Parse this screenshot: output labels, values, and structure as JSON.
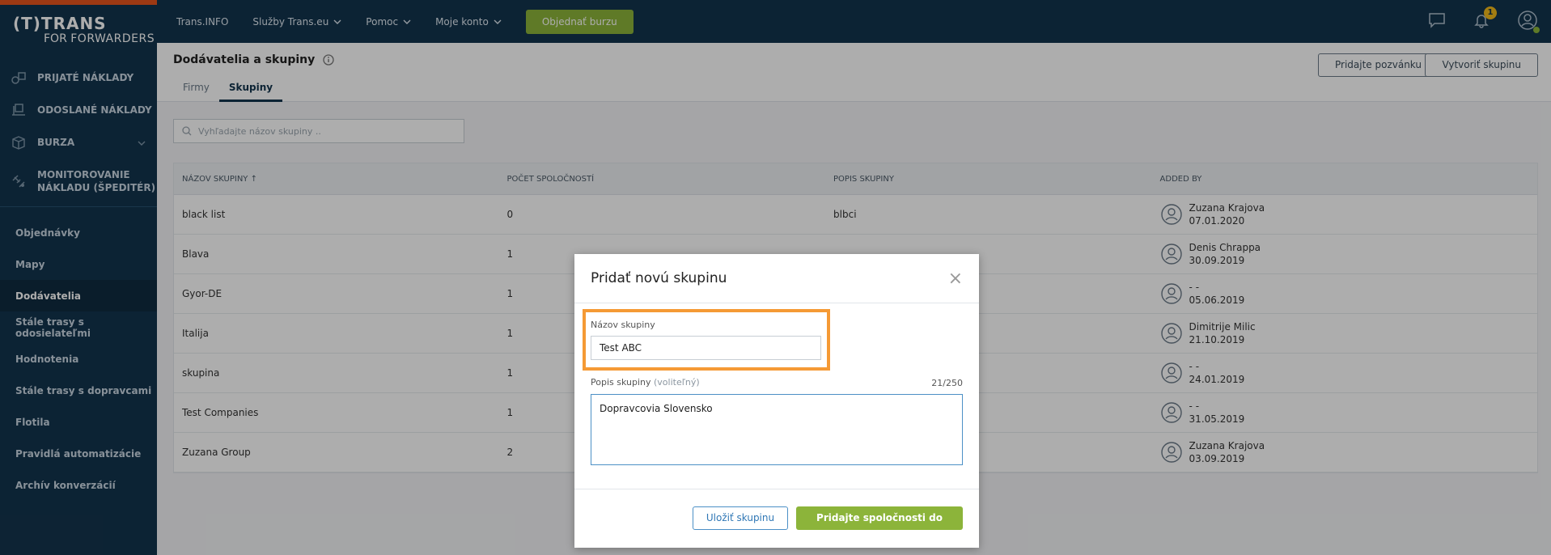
{
  "brand": {
    "line1": "(T)TRANS",
    "line2a": "FOR ",
    "line2b": "FORWARDERS"
  },
  "sidebar": {
    "main": [
      {
        "label": "PRIJATÉ NÁKLADY",
        "icon": "cargo-received-icon"
      },
      {
        "label": "ODOSLANÉ NÁKLADY",
        "icon": "cargo-sent-icon"
      },
      {
        "label": "BURZA",
        "icon": "box-icon"
      },
      {
        "label1": "MONITOROVANIE",
        "label2": "NÁKLADU (ŠPEDITÉR)",
        "icon": "satellite-icon"
      }
    ],
    "sub": [
      {
        "label": "Objednávky"
      },
      {
        "label": "Mapy"
      },
      {
        "label": "Dodávatelia"
      },
      {
        "label": "Stále trasy s odosielateľmi"
      },
      {
        "label": "Hodnotenia"
      },
      {
        "label": "Stále trasy s dopravcami"
      },
      {
        "label": "Flotila"
      },
      {
        "label": "Pravidlá automatizácie"
      },
      {
        "label": "Archív konverzácií"
      }
    ]
  },
  "topnav": {
    "items": [
      "Trans.INFO",
      "Služby Trans.eu",
      "Pomoc",
      "Moje konto"
    ],
    "cta": "Objednať burzu",
    "notif_count": "1"
  },
  "page": {
    "title": "Dodávatelia a skupiny",
    "tabs": [
      "Firmy",
      "Skupiny"
    ],
    "btn_invite": "Pridajte pozvánku",
    "btn_create": "Vytvoriť skupinu",
    "search_placeholder": "Vyhľadajte názov skupiny ..",
    "table": {
      "headers": [
        "NÁZOV SKUPINY ↑",
        "POČET SPOLOČNOSTÍ",
        "POPIS SKUPINY",
        "ADDED BY"
      ],
      "rows": [
        {
          "name": "black list",
          "count": "0",
          "desc": "blbci",
          "by": "Zuzana Krajova",
          "date": "07.01.2020"
        },
        {
          "name": "Blava",
          "count": "1",
          "desc": "",
          "by": "Denis Chrappa",
          "date": "30.09.2019"
        },
        {
          "name": "Gyor-DE",
          "count": "1",
          "desc": "",
          "by": "- -",
          "date": "05.06.2019"
        },
        {
          "name": "Italija",
          "count": "1",
          "desc": "",
          "by": "Dimitrije Milic",
          "date": "21.10.2019"
        },
        {
          "name": "skupina",
          "count": "1",
          "desc": "",
          "by": "- -",
          "date": "24.01.2019"
        },
        {
          "name": "Test Companies",
          "count": "1",
          "desc": "",
          "by": "- -",
          "date": "31.05.2019"
        },
        {
          "name": "Zuzana Group",
          "count": "2",
          "desc": "",
          "by": "Zuzana Krajova",
          "date": "03.09.2019"
        }
      ]
    }
  },
  "modal": {
    "title": "Pridať novú skupinu",
    "name_label": "Názov skupiny",
    "name_value": "Test ABC",
    "desc_label": "Popis skupiny",
    "desc_optional": "(voliteľný)",
    "desc_counter": "21/250",
    "desc_value": "Dopravcovia Slovensko",
    "btn_save": "Uložiť skupinu",
    "btn_add": "Pridajte spoločnosti do skupiny"
  },
  "colors": {
    "sidebar": "#13344d",
    "accent": "#8cb43a",
    "highlight": "#f59a35",
    "topline": "#e8541d"
  }
}
